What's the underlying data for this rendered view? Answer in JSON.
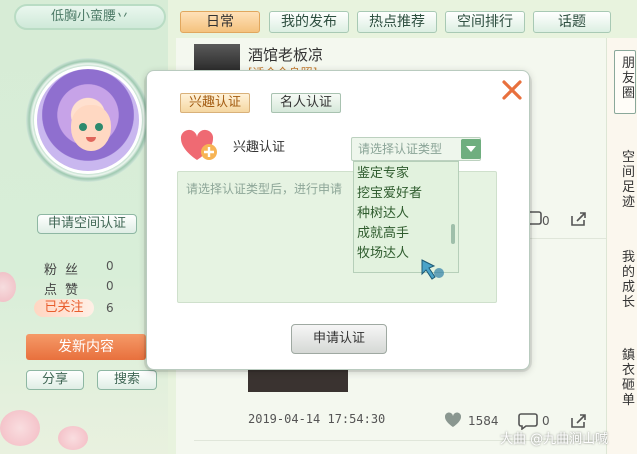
{
  "profile": {
    "nickname": "低胸小蛮腰丷",
    "apply_space_cert": "申请空间认证",
    "stats": [
      {
        "label": "粉丝",
        "value": "0"
      },
      {
        "label": "点赞",
        "value": "0"
      },
      {
        "label": "已关注",
        "value": "6"
      }
    ],
    "post_button": "发新内容",
    "share_button": "分享",
    "search_button": "搜索"
  },
  "tabs": [
    {
      "label": "日常",
      "active": true
    },
    {
      "label": "我的发布",
      "active": false
    },
    {
      "label": "热点推荐",
      "active": false
    },
    {
      "label": "空间排行",
      "active": false
    },
    {
      "label": "话题",
      "active": false
    }
  ],
  "feed": {
    "author": "酒馆老板凉",
    "subtitle": "[适合全身照]",
    "comment_count_top": "0",
    "timestamp": "2019-04-14 17:54:30",
    "like_count": "1584",
    "comment_count": "0"
  },
  "right_panel": {
    "box_text": "朋友圈",
    "col1": "空间足迹",
    "col2": "我的成长",
    "col3": "鎮衣砸单"
  },
  "modal": {
    "tabs": [
      {
        "label": "兴趣认证",
        "active": true
      },
      {
        "label": "名人认证",
        "active": false
      }
    ],
    "section_title": "兴趣认证",
    "select_placeholder": "请选择认证类型",
    "textarea_placeholder": "请选择认证类型后，进行申请",
    "dropdown_options": [
      "鉴定专家",
      "挖宝爱好者",
      "种树达人",
      "成就高手",
      "牧场达人"
    ],
    "submit_button": "申请认证"
  },
  "watermark": "大曲 @九曲涧山喊",
  "colors": {
    "accent_orange": "#e8703d",
    "active_tab": "#f4c27e",
    "close_x": "#e8703d",
    "heart": "#ef6a73"
  }
}
